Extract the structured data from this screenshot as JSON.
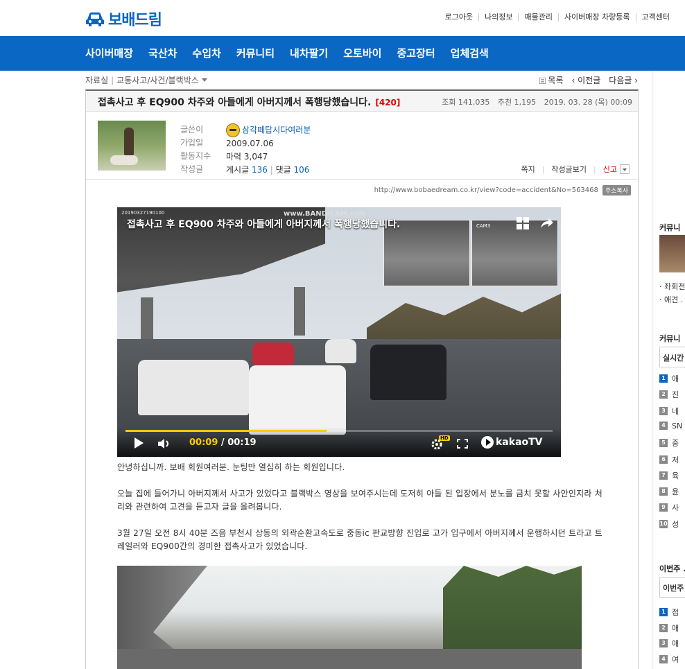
{
  "brand": {
    "name": "보배드림",
    "color": "#0a65bf"
  },
  "util_links": [
    "로그아웃",
    "나의정보",
    "매물관리",
    "사이버매장 차량등록",
    "고객센터"
  ],
  "nav": [
    "사이버매장",
    "국산차",
    "수입차",
    "커뮤니티",
    "내차팔기",
    "오토바이",
    "중고장터",
    "업체검색"
  ],
  "breadcrumb": {
    "root": "자료실",
    "section": "교통사고/사건/블랙박스"
  },
  "pager": {
    "list": "목록",
    "prev": "이전글",
    "next": "다음글"
  },
  "post": {
    "title": "접촉사고 후 EQ900 차주와 아들에게 아버지께서 폭행당했습니다.",
    "comment_count": "[420]",
    "views": "조회 141,035",
    "likes": "추천 1,195",
    "date": "2019. 03. 28 (목) 00:09",
    "url": "http://www.bobaedream.co.kr/view?code=accident&No=563468",
    "copy_label": "주소복사"
  },
  "author": {
    "labels": [
      "글쓴이",
      "가입일",
      "활동지수",
      "작성글"
    ],
    "name": "삼각떼탑시다여러분",
    "joined": "2009.07.06",
    "activity": "마력 3,047",
    "posts_label": "게시글",
    "posts": "136",
    "replies_label": "댓글",
    "replies": "106",
    "actions": {
      "note": "쪽지",
      "view_posts": "작성글보기",
      "report": "신고"
    }
  },
  "video": {
    "title": "접촉사고 후 EQ900 차주와 아들에게 아버지께서 폭행당했습니다.",
    "watermark": "www.BANDICAM.com",
    "timestamp": "20190327190100",
    "cam_label": "CAM3",
    "current": "00:09",
    "duration": "/ 00:19",
    "progress": 0.47,
    "hd": "HD",
    "provider": "kakaoTV"
  },
  "body": [
    "안녕하십니까. 보배 회원여러분. 눈팅만 열심히 하는 회원입니다.",
    "오늘 집에 들어가니 아버지께서 사고가 있었다고 블랙박스 영상을 보여주시는데 도저히 아들 된 입장에서 분노를 금치 못할 사안인지라 처리와 관련하여 고견을 듣고자 글을 올려봅니다.",
    "3월 27일 오전 8시 40분 즈음 부천시 상동의 외곽순환고속도로 중동ic 판교방향 진입로 고가 입구에서 아버지께서 운행하시던 트라고 트레일러와 EQ900간의 경미한 접촉사고가 있었습니다."
  ],
  "sidebar": {
    "sec1": "커뮤니",
    "items1": [
      "· 좌회전",
      "· 애견 ."
    ],
    "sec2": "커뮤니",
    "tab2": "실시간",
    "ranks2": [
      "애",
      "진",
      "네",
      "SN",
      "중",
      "저",
      "육",
      "윤",
      "사",
      "성"
    ],
    "sec3": "이번주 .",
    "tab3": "이번주",
    "ranks3": [
      "접",
      "애",
      "애",
      "여"
    ]
  }
}
